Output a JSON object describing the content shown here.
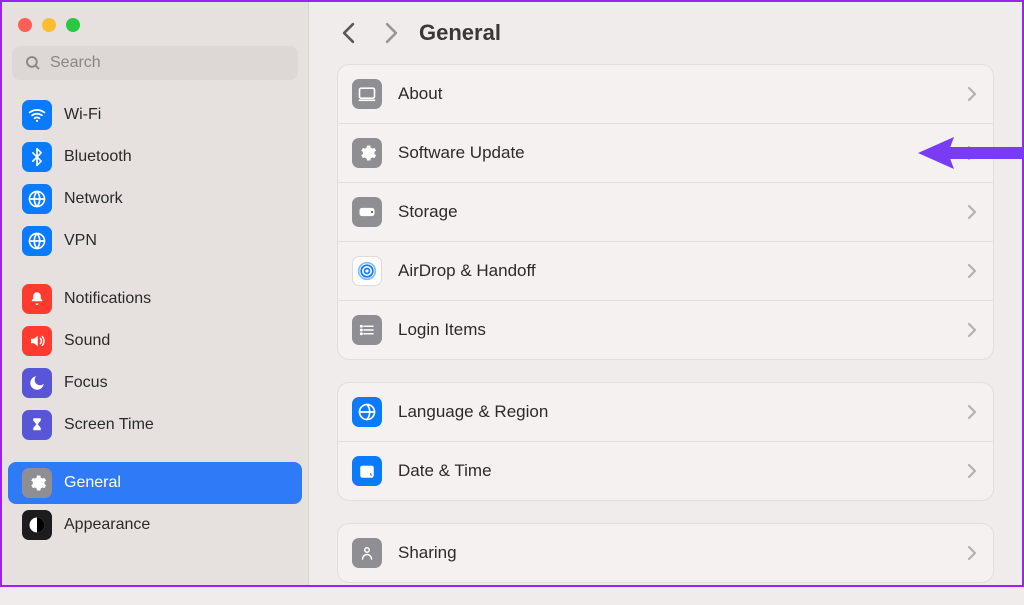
{
  "search": {
    "placeholder": "Search"
  },
  "sidebar": {
    "groups": [
      [
        {
          "label": "Wi-Fi",
          "icon": "wifi",
          "bg": "bg-blue"
        },
        {
          "label": "Bluetooth",
          "icon": "bluetooth",
          "bg": "bg-blue"
        },
        {
          "label": "Network",
          "icon": "network",
          "bg": "bg-blue"
        },
        {
          "label": "VPN",
          "icon": "vpn",
          "bg": "bg-blue"
        }
      ],
      [
        {
          "label": "Notifications",
          "icon": "bell",
          "bg": "bg-red"
        },
        {
          "label": "Sound",
          "icon": "speaker",
          "bg": "bg-red"
        },
        {
          "label": "Focus",
          "icon": "moon",
          "bg": "bg-purple"
        },
        {
          "label": "Screen Time",
          "icon": "hourglass",
          "bg": "bg-purple"
        }
      ],
      [
        {
          "label": "General",
          "icon": "gear",
          "bg": "bg-grey",
          "selected": true
        },
        {
          "label": "Appearance",
          "icon": "appearance",
          "bg": "bg-black"
        }
      ]
    ]
  },
  "header": {
    "title": "General"
  },
  "main": {
    "sections": [
      [
        {
          "label": "About",
          "icon": "about",
          "bg": "bg-grey"
        },
        {
          "label": "Software Update",
          "icon": "gear",
          "bg": "bg-grey",
          "annotated": true
        },
        {
          "label": "Storage",
          "icon": "storage",
          "bg": "bg-grey"
        },
        {
          "label": "AirDrop & Handoff",
          "icon": "airdrop",
          "bg": "bg-white"
        },
        {
          "label": "Login Items",
          "icon": "list",
          "bg": "bg-grey"
        }
      ],
      [
        {
          "label": "Language & Region",
          "icon": "globe-flag",
          "bg": "bg-blue"
        },
        {
          "label": "Date & Time",
          "icon": "calendar",
          "bg": "bg-blue"
        }
      ],
      [
        {
          "label": "Sharing",
          "icon": "sharing",
          "bg": "bg-grey"
        }
      ]
    ]
  },
  "annotation": {
    "color": "#7a3cf2"
  }
}
